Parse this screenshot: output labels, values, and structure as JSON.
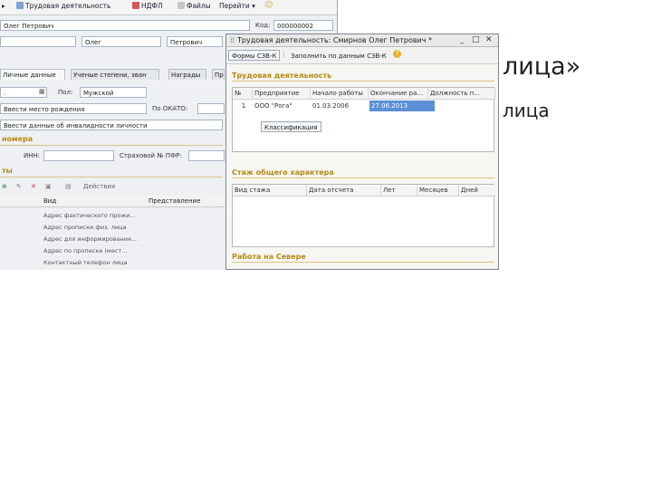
{
  "slide": {
    "title": "лица»",
    "subtitle": "лица"
  },
  "back_window": {
    "toolbar": {
      "item1": "Трудовая деятельность",
      "item2": "НДФЛ",
      "item3": "Файлы",
      "item4": "Перейти"
    },
    "name_field": "Олег Петрович",
    "code_label": "Код:",
    "code_value": "000000002",
    "first_name": "Олег",
    "patronymic": "Петрович",
    "tabs": [
      "Личные данные",
      "Ученые степени, зван",
      "Награды",
      "Пр"
    ],
    "birth_date_value": ".",
    "sex_label": "Пол:",
    "sex_value": "Мужской",
    "birth_place_value": "Ввести место рождения",
    "okato_label": "По ОКАТО:",
    "disability_value": "Ввести данные об инвалидности личности",
    "section_numbers": "номера",
    "inn_label": "ИНН:",
    "snils_label": "Страховой № ПФР:",
    "section_contacts": "ты",
    "contacts_toolbar_label": "Действия",
    "grid_head_view": "Вид",
    "grid_head_view2": "Представление",
    "grid_rows": [
      "Адрес фактического прожи...",
      "Адрес прописки физ. лица",
      "Адрес для информирования...",
      "Адрес по прописке (мест...",
      "Контактный телефон лица"
    ]
  },
  "front_window": {
    "title": "Трудовая деятельность: Смирнов Олег Петрович *",
    "btn_forms": "Формы СЗВ-К",
    "btn_fill": "Заполнить по данным СЗВ-К",
    "section_work": "Трудовая деятельность",
    "work_table": {
      "headers": [
        "№",
        "Предприятие",
        "Начало работы",
        "Окончание ра...",
        "Должность п..."
      ],
      "rows": [
        [
          "1",
          "ООО \"Рога\"",
          "01.03.2006",
          "27.06.2013",
          ""
        ]
      ]
    },
    "btn_classification": "Классификация",
    "section_general": "Стаж общего характера",
    "general_table_headers": [
      "Вид стажа",
      "Дата отсчета",
      "Лет",
      "Месяцев",
      "Дней"
    ],
    "section_north": "Работа на Севере"
  },
  "colors": {
    "section_heading": "#b58a13",
    "selection": "#5b8fd6"
  }
}
